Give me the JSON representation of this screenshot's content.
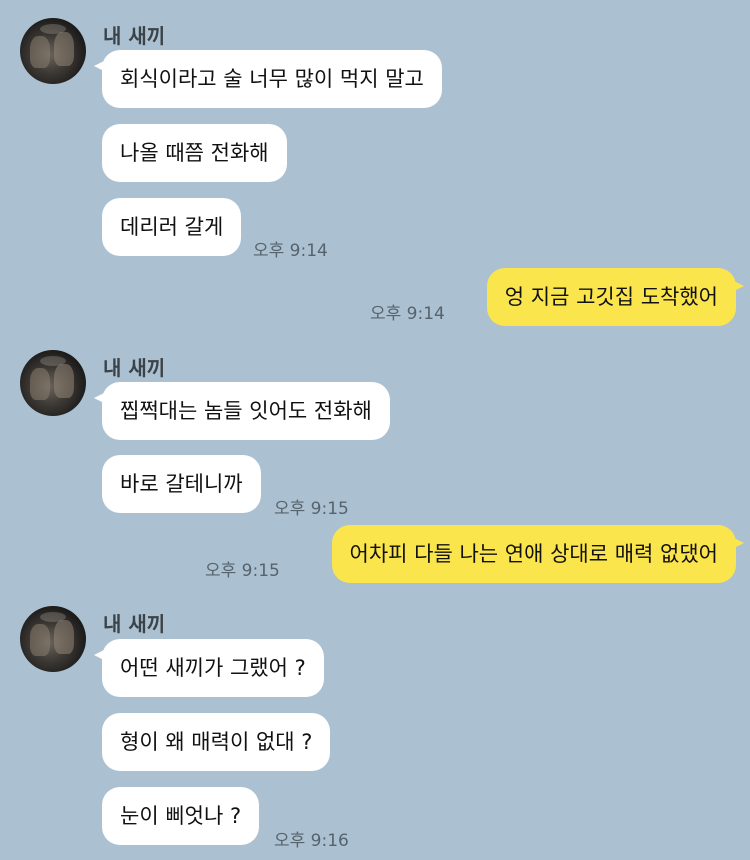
{
  "theme": {
    "background": "#abc1d1",
    "incoming_bubble": "#ffffff",
    "outgoing_bubble": "#fbe54d"
  },
  "groups": [
    {
      "sender": "내 새끼",
      "messages": [
        "회식이라고 술 너무 많이 먹지 말고",
        "나올 때쯤 전화해",
        "데리러 갈게"
      ],
      "time": "오후 9:14"
    },
    {
      "outgoing": "엉 지금 고깃집 도착했어",
      "time": "오후 9:14"
    },
    {
      "sender": "내 새끼",
      "messages": [
        "찝쩍대는 놈들 잇어도 전화해",
        "바로 갈테니까"
      ],
      "time": "오후 9:15"
    },
    {
      "outgoing": "어차피 다들 나는 연애 상대로 매력 없댔어",
      "time": "오후 9:15"
    },
    {
      "sender": "내 새끼",
      "messages": [
        "어떤 새끼가 그랬어 ?",
        "형이 왜 매력이 없대 ?",
        "눈이 삐엇나 ?"
      ],
      "time": "오후 9:16"
    }
  ]
}
